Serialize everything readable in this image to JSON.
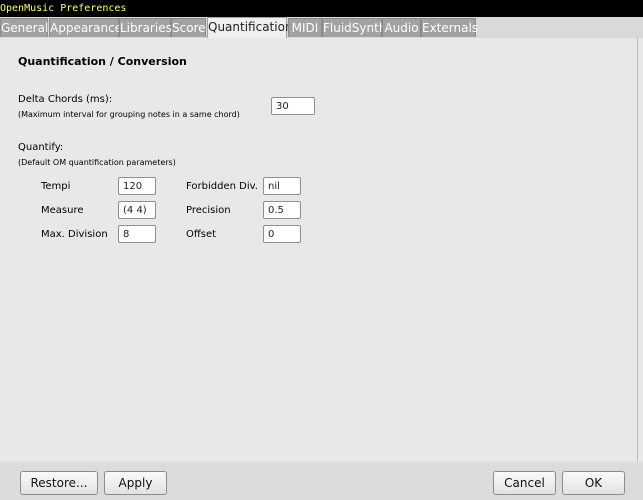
{
  "window": {
    "title": "OpenMusic Preferences"
  },
  "tabs": [
    {
      "label": "General"
    },
    {
      "label": "Appearance"
    },
    {
      "label": "Libraries"
    },
    {
      "label": "Score"
    },
    {
      "label": "Quantification",
      "active": true
    },
    {
      "label": "MIDI"
    },
    {
      "label": "FluidSynth"
    },
    {
      "label": "Audio"
    },
    {
      "label": "Externals"
    }
  ],
  "section": {
    "title": "Quantification / Conversion",
    "delta_chords": {
      "label": "Delta Chords (ms):",
      "hint": "(Maximum interval for grouping notes in a same chord)",
      "value": "30"
    },
    "quantify": {
      "label": "Quantify:",
      "hint": "(Default OM quantification parameters)",
      "tempi": {
        "label": "Tempi",
        "value": "120"
      },
      "measure": {
        "label": "Measure",
        "value": "(4 4)"
      },
      "max_division": {
        "label": "Max. Division",
        "value": "8"
      },
      "forbidden_div": {
        "label": "Forbidden Div.",
        "value": "nil"
      },
      "precision": {
        "label": "Precision",
        "value": "0.5"
      },
      "offset": {
        "label": "Offset",
        "value": "0"
      }
    }
  },
  "buttons": {
    "restore": "Restore...",
    "apply": "Apply",
    "cancel": "Cancel",
    "ok": "OK"
  }
}
